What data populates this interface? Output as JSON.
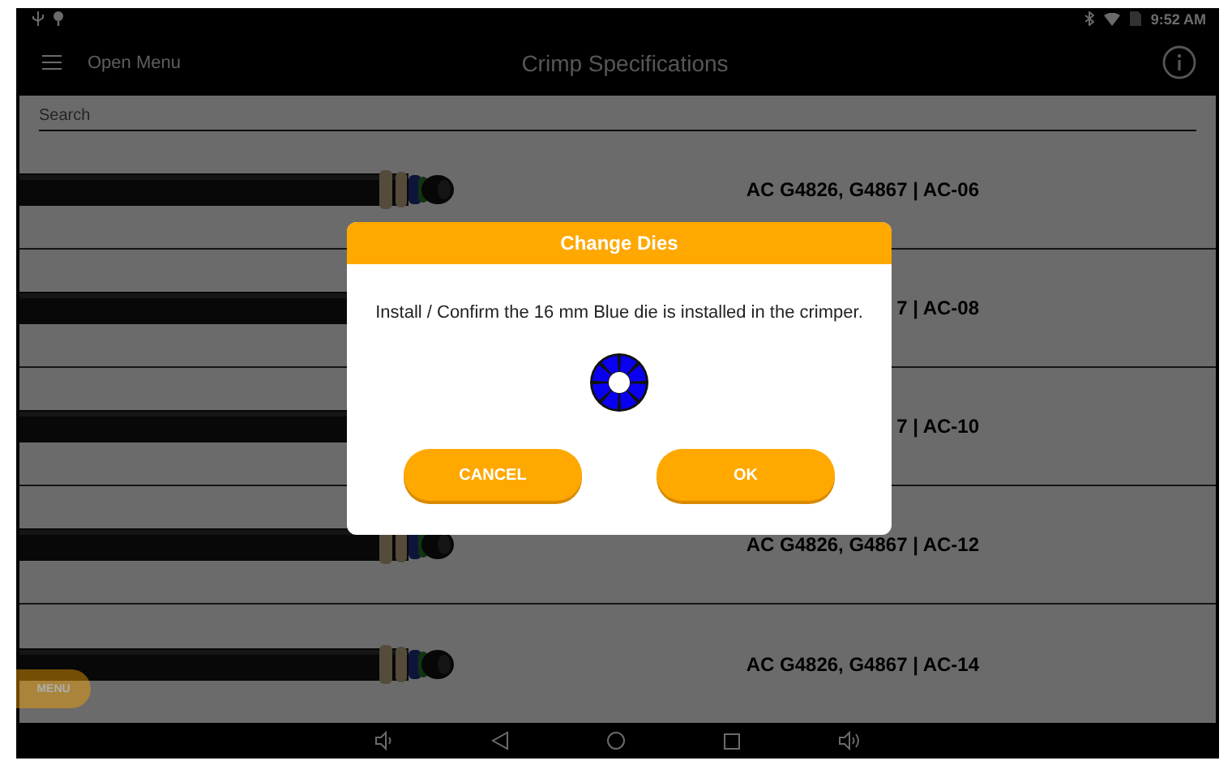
{
  "status_bar": {
    "time": "9:52 AM"
  },
  "app_bar": {
    "menu_label": "Open Menu",
    "title": "Crimp Specifications"
  },
  "search": {
    "placeholder": "Search"
  },
  "rows": [
    {
      "label": "AC G4826, G4867 | AC-06"
    },
    {
      "label": "7 | AC-08"
    },
    {
      "label": "7 | AC-10"
    },
    {
      "label": "AC G4826, G4867 | AC-12"
    },
    {
      "label": "AC G4826, G4867 | AC-14"
    }
  ],
  "menu_button": "MENU",
  "dialog": {
    "title": "Change Dies",
    "message": "Install / Confirm the 16 mm Blue die is installed in the crimper.",
    "buttons": [
      "CANCEL",
      "OK"
    ]
  }
}
